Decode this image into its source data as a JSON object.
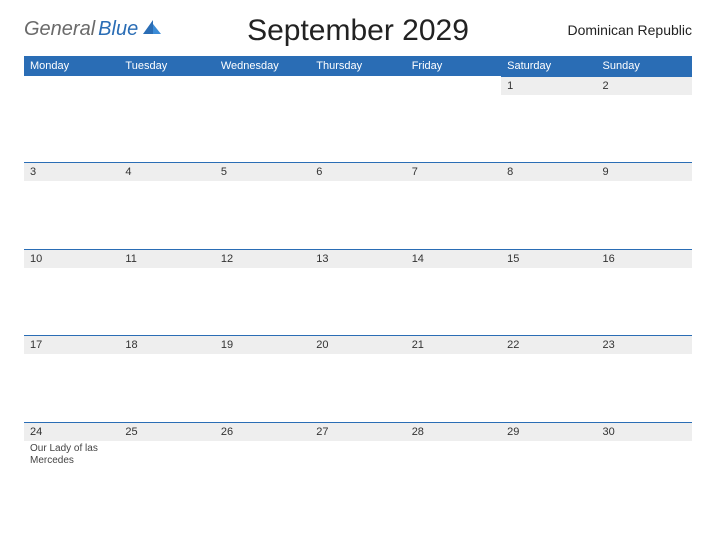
{
  "logo": {
    "part1": "General",
    "part2": "Blue"
  },
  "title": "September 2029",
  "country": "Dominican Republic",
  "days": [
    "Monday",
    "Tuesday",
    "Wednesday",
    "Thursday",
    "Friday",
    "Saturday",
    "Sunday"
  ],
  "weeks": [
    {
      "nums": [
        "",
        "",
        "",
        "",
        "",
        "1",
        "2"
      ],
      "notes": [
        "",
        "",
        "",
        "",
        "",
        "",
        ""
      ]
    },
    {
      "nums": [
        "3",
        "4",
        "5",
        "6",
        "7",
        "8",
        "9"
      ],
      "notes": [
        "",
        "",
        "",
        "",
        "",
        "",
        ""
      ]
    },
    {
      "nums": [
        "10",
        "11",
        "12",
        "13",
        "14",
        "15",
        "16"
      ],
      "notes": [
        "",
        "",
        "",
        "",
        "",
        "",
        ""
      ]
    },
    {
      "nums": [
        "17",
        "18",
        "19",
        "20",
        "21",
        "22",
        "23"
      ],
      "notes": [
        "",
        "",
        "",
        "",
        "",
        "",
        ""
      ]
    },
    {
      "nums": [
        "24",
        "25",
        "26",
        "27",
        "28",
        "29",
        "30"
      ],
      "notes": [
        "Our Lady of las Mercedes",
        "",
        "",
        "",
        "",
        "",
        ""
      ]
    }
  ]
}
